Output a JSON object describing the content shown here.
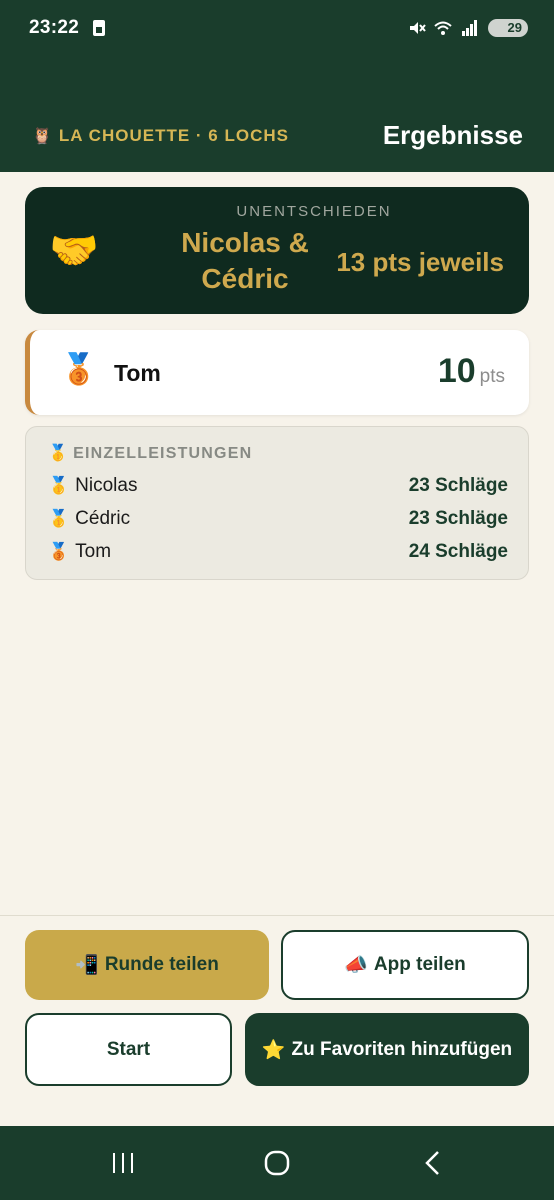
{
  "status_bar": {
    "time": "23:22",
    "battery": "29",
    "icons": [
      "sim-card-icon",
      "mute-icon",
      "wifi-icon",
      "signal-icon",
      "battery-icon"
    ]
  },
  "header": {
    "owl_icon": "🦉",
    "subtitle": "LA CHOUETTE · 6 LOCHS",
    "title": "Ergebnisse"
  },
  "winner": {
    "label": "UNENTSCHIEDEN",
    "icon": "🤝",
    "names_line1": "Nicolas &",
    "names_line2": "Cédric",
    "points": "13 pts jeweils"
  },
  "third_place": {
    "medal": "🥉",
    "name": "Tom",
    "score": "10",
    "unit": "pts"
  },
  "individual": {
    "icon": "🥇",
    "title": "EINZELLEISTUNGEN",
    "rows": [
      {
        "medal": "🥇",
        "name": "Nicolas",
        "strokes": "23 Schläge"
      },
      {
        "medal": "🥇",
        "name": "Cédric",
        "strokes": "23 Schläge"
      },
      {
        "medal": "🥉",
        "name": "Tom",
        "strokes": "24 Schläge"
      }
    ]
  },
  "actions": {
    "share_round_icon": "📲",
    "share_round": "Runde teilen",
    "share_app_icon": "📣",
    "share_app": "App teilen",
    "start": "Start",
    "favorite_icon": "⭐",
    "favorite": "Zu Favoriten hinzufügen"
  },
  "colors": {
    "primary": "#1a3d2c",
    "gold": "#c9a94a",
    "background": "#f7f3ea",
    "bronze": "#c8893f"
  }
}
